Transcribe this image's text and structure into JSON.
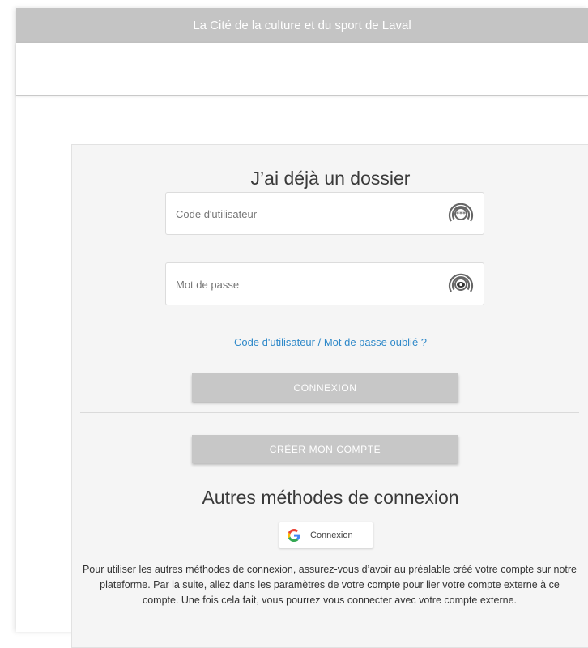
{
  "header": {
    "title": "La Cité de la culture et du sport de Laval"
  },
  "login": {
    "heading": "J’ai déjà un dossier",
    "username_placeholder": "Code d'utilisateur",
    "username_value": "",
    "password_placeholder": "Mot de passe",
    "password_value": "",
    "forgot_link": "Code d'utilisateur / Mot de passe oublié ?",
    "connect_button": "CONNEXION",
    "create_button": "CRÉER MON COMPTE"
  },
  "other_methods": {
    "heading": "Autres méthodes de connexion",
    "google_button": "Connexion",
    "note": "Pour utiliser les autres méthodes de connexion, assurez-vous d’avoir au préalable créé votre compte sur notre plateforme. Par la suite, allez dans les paramètres de votre compte pour lier votre compte externe à ce compte. Une fois cela fait, vous pourrez vous connecter avec votre compte externe."
  },
  "icons": {
    "username_icon": "fingerprint-asterisk-icon",
    "password_icon": "fingerprint-eye-icon",
    "google_icon": "google-g-icon"
  },
  "colors": {
    "topbar": "#c4c4c4",
    "button": "#c7c7c7",
    "link": "#2f89c9",
    "panel": "#f5f5f5"
  }
}
